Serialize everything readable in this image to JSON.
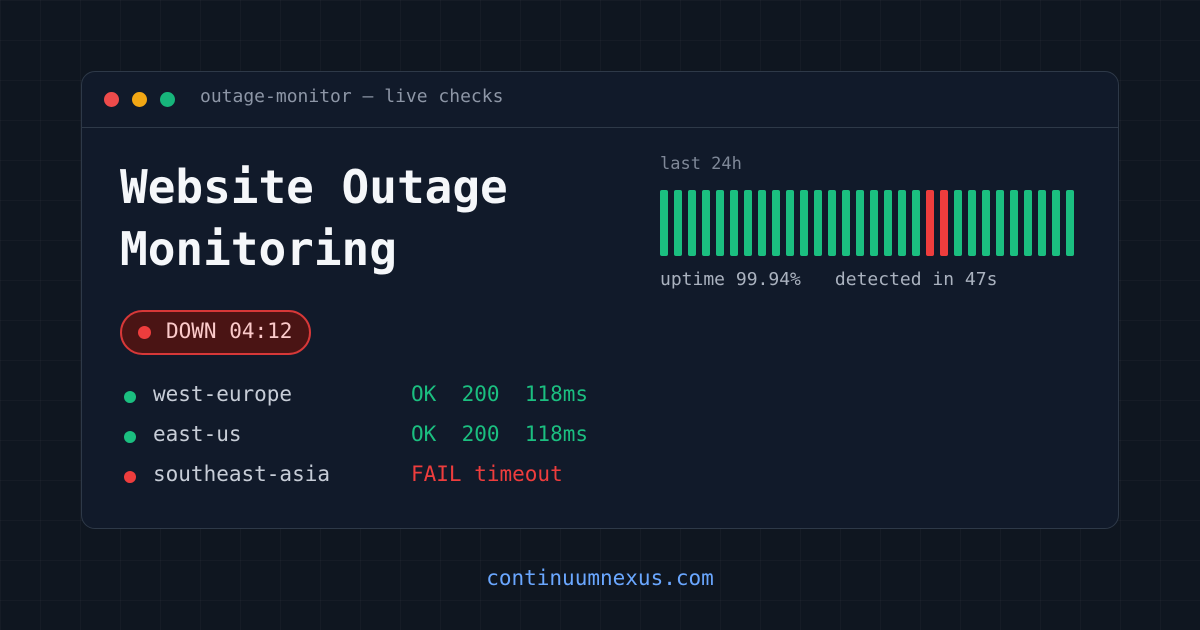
{
  "colors": {
    "ok": "#1bbf80",
    "fail": "#ee3d3d",
    "link": "#6aa7ff",
    "dot_red": "#ee4b4b",
    "dot_yellow": "#f2a714",
    "dot_green": "#17b57b"
  },
  "window": {
    "title": "outage-monitor — live checks"
  },
  "headline": {
    "line1": "Website Outage",
    "line2": "Monitoring"
  },
  "status_badge": {
    "text": "DOWN 04:12",
    "state": "down"
  },
  "regions": [
    {
      "name": "west-europe",
      "status": "OK  200  118ms",
      "state": "ok"
    },
    {
      "name": "east-us",
      "status": "OK  200  118ms",
      "state": "ok"
    },
    {
      "name": "southeast-asia",
      "status": "FAIL timeout",
      "state": "fail"
    }
  ],
  "history": {
    "label": "last 24h",
    "bars": [
      "ok",
      "ok",
      "ok",
      "ok",
      "ok",
      "ok",
      "ok",
      "ok",
      "ok",
      "ok",
      "ok",
      "ok",
      "ok",
      "ok",
      "ok",
      "ok",
      "ok",
      "ok",
      "ok",
      "fail",
      "fail",
      "ok",
      "ok",
      "ok",
      "ok",
      "ok",
      "ok",
      "ok",
      "ok",
      "ok"
    ],
    "uptime": "uptime 99.94%",
    "detected": "detected in 47s"
  },
  "footer": {
    "link": "continuumnexus.com"
  }
}
